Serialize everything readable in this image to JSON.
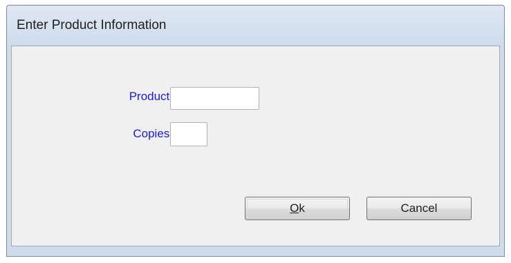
{
  "window": {
    "title": "Enter Product Information"
  },
  "form": {
    "product_label": "Product:",
    "product_value": "",
    "copies_label": "Copies:",
    "copies_value": ""
  },
  "buttons": {
    "ok_mnemonic": "O",
    "ok_rest": "k",
    "cancel_label": "Cancel"
  },
  "colors": {
    "label_color": "#1a1adc",
    "frame_color": "#cfdcec"
  }
}
